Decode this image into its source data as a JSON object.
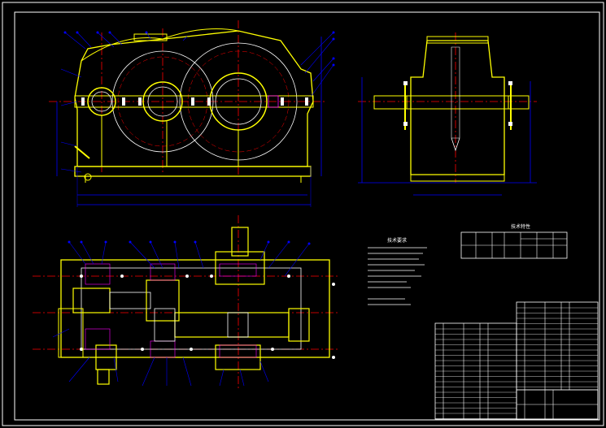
{
  "drawing": {
    "notes_heading": "技术要求",
    "spec_table_title": "技术特性"
  },
  "colors": {
    "background": "#000000",
    "frame": "#ffffff",
    "outline": "#ffff00",
    "center_line": "#ff0000",
    "dimension": "#0000ff",
    "leader": "#0000ff",
    "hatch": "#ff00ff",
    "text": "#ffffff"
  },
  "icons": [
    "gear-icon",
    "bolt-icon",
    "shaft-icon"
  ]
}
